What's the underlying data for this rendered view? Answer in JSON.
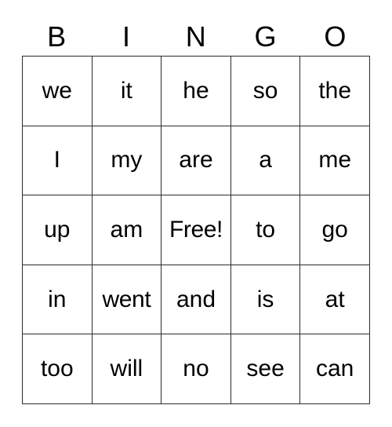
{
  "card": {
    "title": "BINGO",
    "columns": [
      "B",
      "I",
      "N",
      "G",
      "O"
    ],
    "free_space_label": "Free!",
    "colors": {
      "background": "#ffffff",
      "text": "#000000",
      "border": "#2b2b2b"
    },
    "rows": [
      {
        "cells": [
          "we",
          "it",
          "he",
          "so",
          "the"
        ]
      },
      {
        "cells": [
          "I",
          "my",
          "are",
          "a",
          "me"
        ]
      },
      {
        "cells": [
          "up",
          "am",
          "Free!",
          "to",
          "go"
        ]
      },
      {
        "cells": [
          "in",
          "went",
          "and",
          "is",
          "at"
        ]
      },
      {
        "cells": [
          "too",
          "will",
          "no",
          "see",
          "can"
        ]
      }
    ]
  }
}
